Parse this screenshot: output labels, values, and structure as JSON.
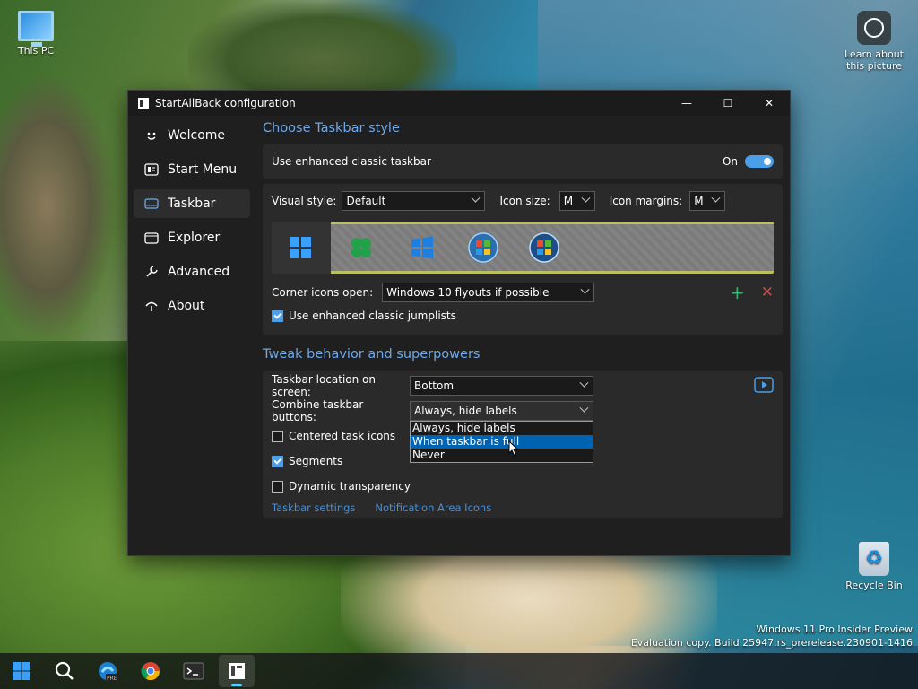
{
  "desktop": {
    "icons": [
      {
        "label": "This PC",
        "icon": "monitor-icon"
      },
      {
        "label": "Learn about this picture",
        "icon": "camera-info-icon"
      },
      {
        "label": "Recycle Bin",
        "icon": "recycle-bin-icon"
      }
    ],
    "watermark": {
      "line1": "Windows 11 Pro Insider Preview",
      "line2": "Evaluation copy. Build 25947.rs_prerelease.230901-1416"
    }
  },
  "window": {
    "title": "StartAllBack configuration",
    "controls": {
      "minimize": "—",
      "maximize": "☐",
      "close": "✕"
    }
  },
  "sidebar": {
    "items": [
      {
        "label": "Welcome",
        "icon": "smile-icon"
      },
      {
        "label": "Start Menu",
        "icon": "start-menu-icon"
      },
      {
        "label": "Taskbar",
        "icon": "taskbar-icon",
        "selected": true
      },
      {
        "label": "Explorer",
        "icon": "explorer-icon"
      },
      {
        "label": "Advanced",
        "icon": "wrench-icon"
      },
      {
        "label": "About",
        "icon": "about-icon"
      }
    ]
  },
  "style_section": {
    "title": "Choose Taskbar style",
    "enhanced_label": "Use enhanced classic taskbar",
    "enhanced_state": "On",
    "visual_style_label": "Visual style:",
    "visual_style_value": "Default",
    "icon_size_label": "Icon size:",
    "icon_size_value": "M",
    "icon_margins_label": "Icon margins:",
    "icon_margins_value": "M",
    "corner_icons_label": "Corner icons open:",
    "corner_icons_value": "Windows 10 flyouts if possible",
    "jumplists_label": "Use enhanced classic jumplists",
    "jumplists_checked": true
  },
  "behavior_section": {
    "title": "Tweak behavior and superpowers",
    "location_label": "Taskbar location on screen:",
    "location_value": "Bottom",
    "combine_label": "Combine taskbar buttons:",
    "combine_value": "Always, hide labels",
    "combine_options": [
      "Always, hide labels",
      "When taskbar is full",
      "Never"
    ],
    "combine_highlighted": 1,
    "centered_label": "Centered task icons",
    "centered_checked": false,
    "segments_label": "Segments",
    "segments_checked": true,
    "dynamic_label": "Dynamic transparency",
    "dynamic_checked": false,
    "link_taskbar_settings": "Taskbar settings",
    "link_notification": "Notification Area Icons"
  },
  "taskbar": {
    "apps": [
      "start-icon",
      "search-icon",
      "edge-dev-icon",
      "chrome-icon",
      "terminal-icon",
      "startallback-icon"
    ]
  },
  "colors": {
    "accent": "#4a9fe8",
    "link": "#4a8fd8",
    "heading": "#6fa8e8"
  }
}
